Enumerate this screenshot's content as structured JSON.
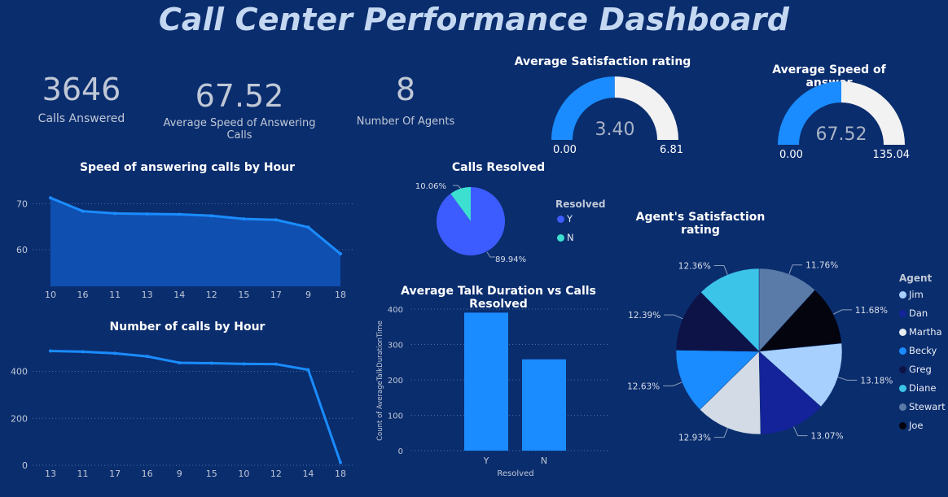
{
  "dashboard": {
    "title": "Call Center Performance Dashboard"
  },
  "kpis": [
    {
      "value": "3646",
      "label": "Calls Answered"
    },
    {
      "value": "67.52",
      "label": "Average Speed of Answering Calls"
    },
    {
      "value": "8",
      "label": "Number Of Agents"
    }
  ],
  "colors": {
    "background": "#0a2d6e",
    "accent": "#1a8cff",
    "gauge_track": "#f2f2f2",
    "resolved_y": "#3d5cff",
    "resolved_n": "#3de0d0"
  },
  "chart_data": [
    {
      "type": "gauge",
      "title": "Average Satisfaction rating",
      "value": 3.4,
      "min": 0,
      "max": 6.81,
      "value_label": "3.40",
      "min_label": "0.00",
      "max_label": "6.81"
    },
    {
      "type": "gauge",
      "title": "Average Speed of answer",
      "value": 67.52,
      "min": 0,
      "max": 135.04,
      "value_label": "67.52",
      "min_label": "0.00",
      "max_label": "135.04"
    },
    {
      "type": "area",
      "title": "Speed of answering calls by Hour",
      "categories": [
        "10",
        "16",
        "11",
        "13",
        "14",
        "12",
        "15",
        "17",
        "9",
        "18"
      ],
      "values": [
        71.3,
        68.4,
        67.9,
        67.8,
        67.7,
        67.4,
        66.7,
        66.5,
        64.9,
        59.1
      ],
      "ylim": [
        52,
        74
      ],
      "yticks": [
        60,
        70
      ],
      "grid": true
    },
    {
      "type": "line",
      "title": "Number of calls by Hour",
      "categories": [
        "13",
        "11",
        "17",
        "16",
        "9",
        "15",
        "10",
        "12",
        "14",
        "18"
      ],
      "values": [
        487,
        484,
        477,
        464,
        437,
        435,
        432,
        431,
        407,
        12
      ],
      "ylim": [
        0,
        520
      ],
      "yticks": [
        0,
        200,
        400
      ],
      "grid": true
    },
    {
      "type": "pie",
      "title": "Calls Resolved",
      "legend_title": "Resolved",
      "categories": [
        "Y",
        "N"
      ],
      "values": [
        89.94,
        10.06
      ],
      "labels": [
        "89.94%",
        "10.06%"
      ],
      "colors": [
        "#3d5cff",
        "#3de0d0"
      ]
    },
    {
      "type": "bar",
      "title": "Average Talk Duration vs Calls Resolved",
      "categories": [
        "Y",
        "N"
      ],
      "values": [
        390,
        258
      ],
      "xlabel": "Resolved",
      "ylabel": "Count of AverageTalkDurationTime",
      "ylim": [
        0,
        400
      ],
      "yticks": [
        0,
        100,
        200,
        300,
        400
      ],
      "grid": true
    },
    {
      "type": "pie",
      "title": "Agent's Satisfaction rating",
      "legend_title": "Agent",
      "legend": [
        "Jim",
        "Dan",
        "Martha",
        "Becky",
        "Greg",
        "Diane",
        "Stewart",
        "Joe"
      ],
      "legend_colors": [
        "#a8d0ff",
        "#14239a",
        "#e8edf2",
        "#1a8cff",
        "#0d1247",
        "#3cc4e8",
        "#5a7ba8",
        "#04040e"
      ],
      "slices": [
        {
          "name": "Stewart",
          "value": 11.76,
          "label": "11.76%",
          "color": "#5a7ba8"
        },
        {
          "name": "Joe",
          "value": 11.68,
          "label": "11.68%",
          "color": "#04040e"
        },
        {
          "name": "Jim",
          "value": 13.18,
          "label": "13.18%",
          "color": "#a8d0ff"
        },
        {
          "name": "Dan",
          "value": 13.07,
          "label": "13.07%",
          "color": "#14239a"
        },
        {
          "name": "Martha",
          "value": 12.93,
          "label": "12.93%",
          "color": "#d2dbe6"
        },
        {
          "name": "Becky",
          "value": 12.63,
          "label": "12.63%",
          "color": "#1a8cff"
        },
        {
          "name": "Greg",
          "value": 12.39,
          "label": "12.39%",
          "color": "#0d1247"
        },
        {
          "name": "Diane",
          "value": 12.36,
          "label": "12.36%",
          "color": "#3cc4e8"
        }
      ]
    }
  ]
}
